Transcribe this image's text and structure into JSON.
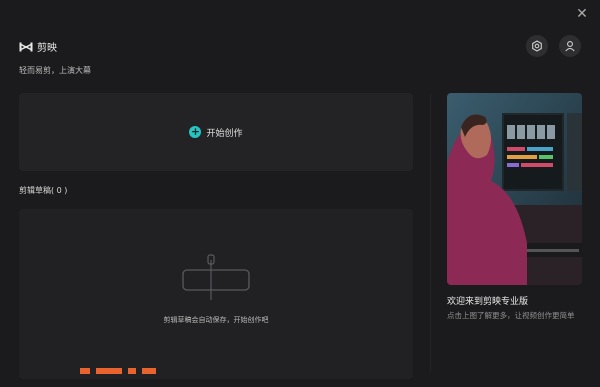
{
  "window": {
    "close_label": "✕"
  },
  "brand": {
    "name": "剪映",
    "tagline": "轻而易剪，上演大幕"
  },
  "header": {
    "settings_icon": "settings-icon",
    "user_icon": "user-icon"
  },
  "create": {
    "label": "开始创作",
    "icon": "plus-icon",
    "accent": "#25c5c4"
  },
  "drafts": {
    "title": "剪辑草稿( 0 )",
    "empty_text": "剪辑草稿会自动保存，开始创作吧"
  },
  "promo": {
    "title": "欢迎来到剪映专业版",
    "description": "点击上图了解更多，让视频创作更简单"
  }
}
